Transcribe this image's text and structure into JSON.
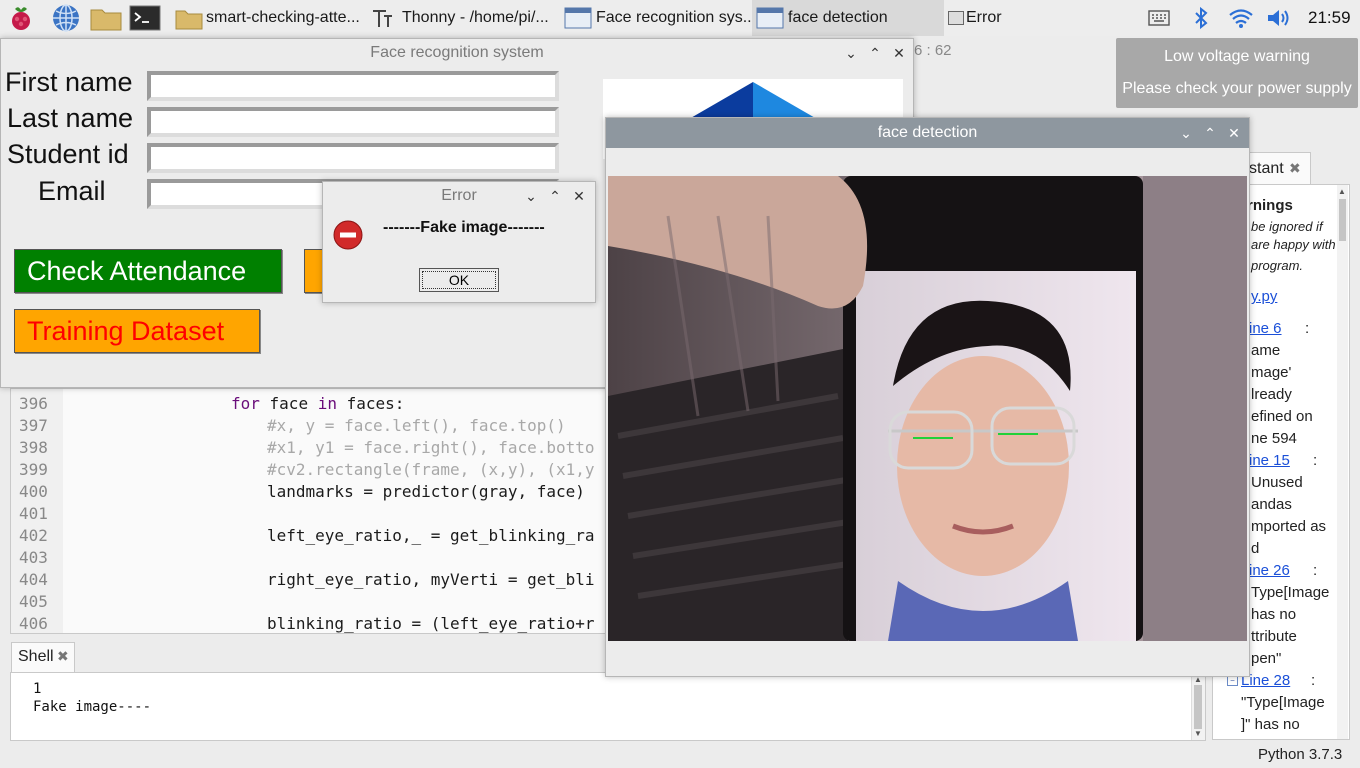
{
  "taskbar": {
    "tasks": [
      {
        "label": "smart-checking-atte..."
      },
      {
        "label": "Thonny  -  /home/pi/..."
      },
      {
        "label": "Face recognition sys..."
      },
      {
        "label": "face detection"
      },
      {
        "label": "Error"
      }
    ],
    "clock": "21:59"
  },
  "low_voltage": {
    "title": "Low voltage warning",
    "message": "Please check your power supply"
  },
  "thonny": {
    "cursor_position": "6 : 62",
    "code_lines": [
      {
        "num": "396",
        "text": "for face in faces:"
      },
      {
        "num": "397",
        "text": "#x, y = face.left(), face.top()"
      },
      {
        "num": "398",
        "text": "#x1, y1 = face.right(), face.botto"
      },
      {
        "num": "399",
        "text": "#cv2.rectangle(frame, (x,y), (x1,y"
      },
      {
        "num": "400",
        "text": "landmarks = predictor(gray, face)"
      },
      {
        "num": "401",
        "text": ""
      },
      {
        "num": "402",
        "text": "left_eye_ratio,_ = get_blinking_ra"
      },
      {
        "num": "403",
        "text": ""
      },
      {
        "num": "404",
        "text": "right_eye_ratio, myVerti = get_bli"
      },
      {
        "num": "405",
        "text": ""
      },
      {
        "num": "406",
        "text": "blinking_ratio = (left_eye_ratio+r"
      }
    ],
    "shell": {
      "tab": "Shell",
      "lines": [
        "1",
        "Fake image----"
      ]
    },
    "assistant": {
      "tab": "stant",
      "heading": "rnings",
      "intro": [
        "be ignored if",
        "are happy with",
        "program."
      ],
      "file_link": "y.py",
      "items": [
        {
          "link": "ine 6",
          "lines": [
            "ame",
            "mage'",
            "lready",
            "efined on",
            "ne 594"
          ]
        },
        {
          "link": "ine 15",
          "lines": [
            "Unused",
            "andas",
            "mported as",
            "d"
          ]
        },
        {
          "link": "ine 26",
          "lines": [
            "Type[Image",
            "has no",
            "ttribute",
            "pen\""
          ]
        },
        {
          "link": "Line 28",
          "lines": [
            "\"Type[Image",
            "]\" has no"
          ]
        }
      ]
    },
    "status": "Python 3.7.3"
  },
  "face_recognition": {
    "title": "Face recognition system",
    "fields": [
      {
        "label": "First name",
        "value": ""
      },
      {
        "label": "Last name",
        "value": ""
      },
      {
        "label": "Student id",
        "value": ""
      },
      {
        "label": "Email",
        "value": ""
      }
    ],
    "check_attendance": "Check Attendance",
    "training_dataset": "Training Dataset",
    "colors": {
      "check_bg": "#008000",
      "check_fg": "#ffffff",
      "train_bg": "#ffa500",
      "train_fg": "#ff0000"
    }
  },
  "error_dialog": {
    "title": "Error",
    "message": "-------Fake image-------",
    "ok": "OK"
  },
  "face_detection": {
    "title": "face detection"
  }
}
